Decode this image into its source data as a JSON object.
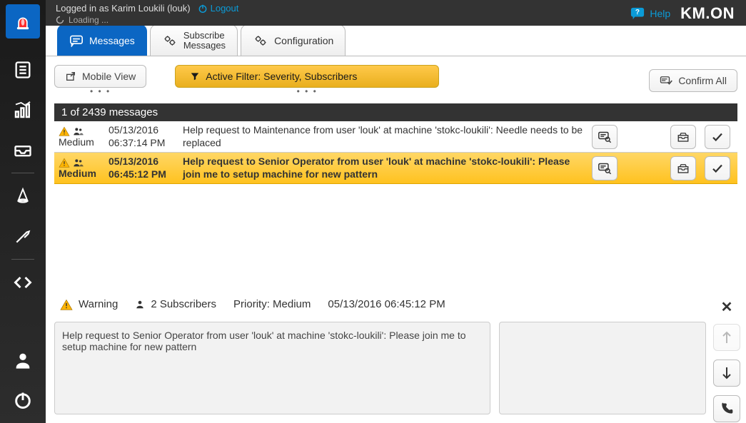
{
  "header": {
    "logged_in_text": "Logged in as Karim Loukili (louk)",
    "logout_label": "Logout",
    "loading_text": "Loading ...",
    "help_label": "Help",
    "brand": "KM.ON"
  },
  "tabs": {
    "messages": "Messages",
    "subscribe_line1": "Subscribe",
    "subscribe_line2": "Messages",
    "configuration": "Configuration"
  },
  "toolbar": {
    "mobile_view": "Mobile View",
    "active_filter": "Active Filter: Severity, Subscribers",
    "confirm_all": "Confirm All"
  },
  "count": {
    "text": "1 of 2439 messages"
  },
  "messages": [
    {
      "severity": "Medium",
      "date": "05/13/2016",
      "time": "06:37:14 PM",
      "text": "Help request to Maintenance from user 'louk' at machine 'stokc-loukili': Needle needs to be replaced",
      "selected": false
    },
    {
      "severity": "Medium",
      "date": "05/13/2016",
      "time": "06:45:12 PM",
      "text": "Help request to Senior Operator from user 'louk' at machine 'stokc-loukili': Please join me to setup machine for new pattern",
      "selected": true
    }
  ],
  "detail": {
    "warning_label": "Warning",
    "subscribers_label": "2 Subscribers",
    "priority_label": "Priority: Medium",
    "timestamp": "05/13/2016 06:45:12 PM",
    "body": "Help request to Senior Operator from user 'louk' at machine 'stokc-loukili': Please join me to setup machine for new pattern"
  },
  "icons": {
    "search-chat": "search-chat-icon",
    "archive": "archive-icon",
    "check": "check-icon"
  }
}
